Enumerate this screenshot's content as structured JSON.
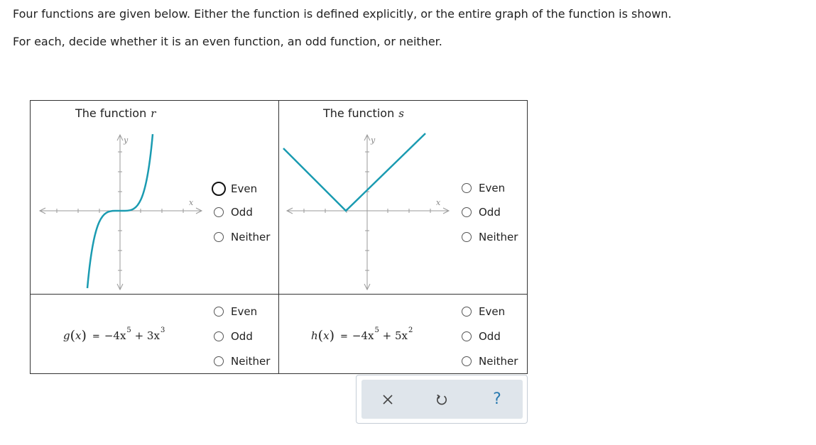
{
  "instructions": {
    "line1": "Four functions are given below. Either the function is defined explicitly, or the entire graph of the function is shown.",
    "line2": "For each, decide whether it is an even function, an odd function, or neither."
  },
  "graph_r": {
    "title_prefix": "The function",
    "title_var": "r",
    "axis_x": "x",
    "axis_y": "y",
    "curve_color": "#1a9bb1"
  },
  "graph_s": {
    "title_prefix": "The function",
    "title_var": "s",
    "axis_x": "x",
    "axis_y": "y",
    "curve_color": "#1a9bb1"
  },
  "formula_g": {
    "name": "g",
    "arg": "x",
    "eq": "=",
    "coef1": "−4x",
    "exp1": "5",
    "op": "+",
    "coef2": "3x",
    "exp2": "3"
  },
  "formula_h": {
    "name": "h",
    "arg": "x",
    "eq": "=",
    "coef1": "−4x",
    "exp1": "5",
    "op": "+",
    "coef2": "5x",
    "exp2": "2"
  },
  "options": [
    "Even",
    "Odd",
    "Neither"
  ],
  "toolbar": {
    "help_glyph": "?"
  }
}
